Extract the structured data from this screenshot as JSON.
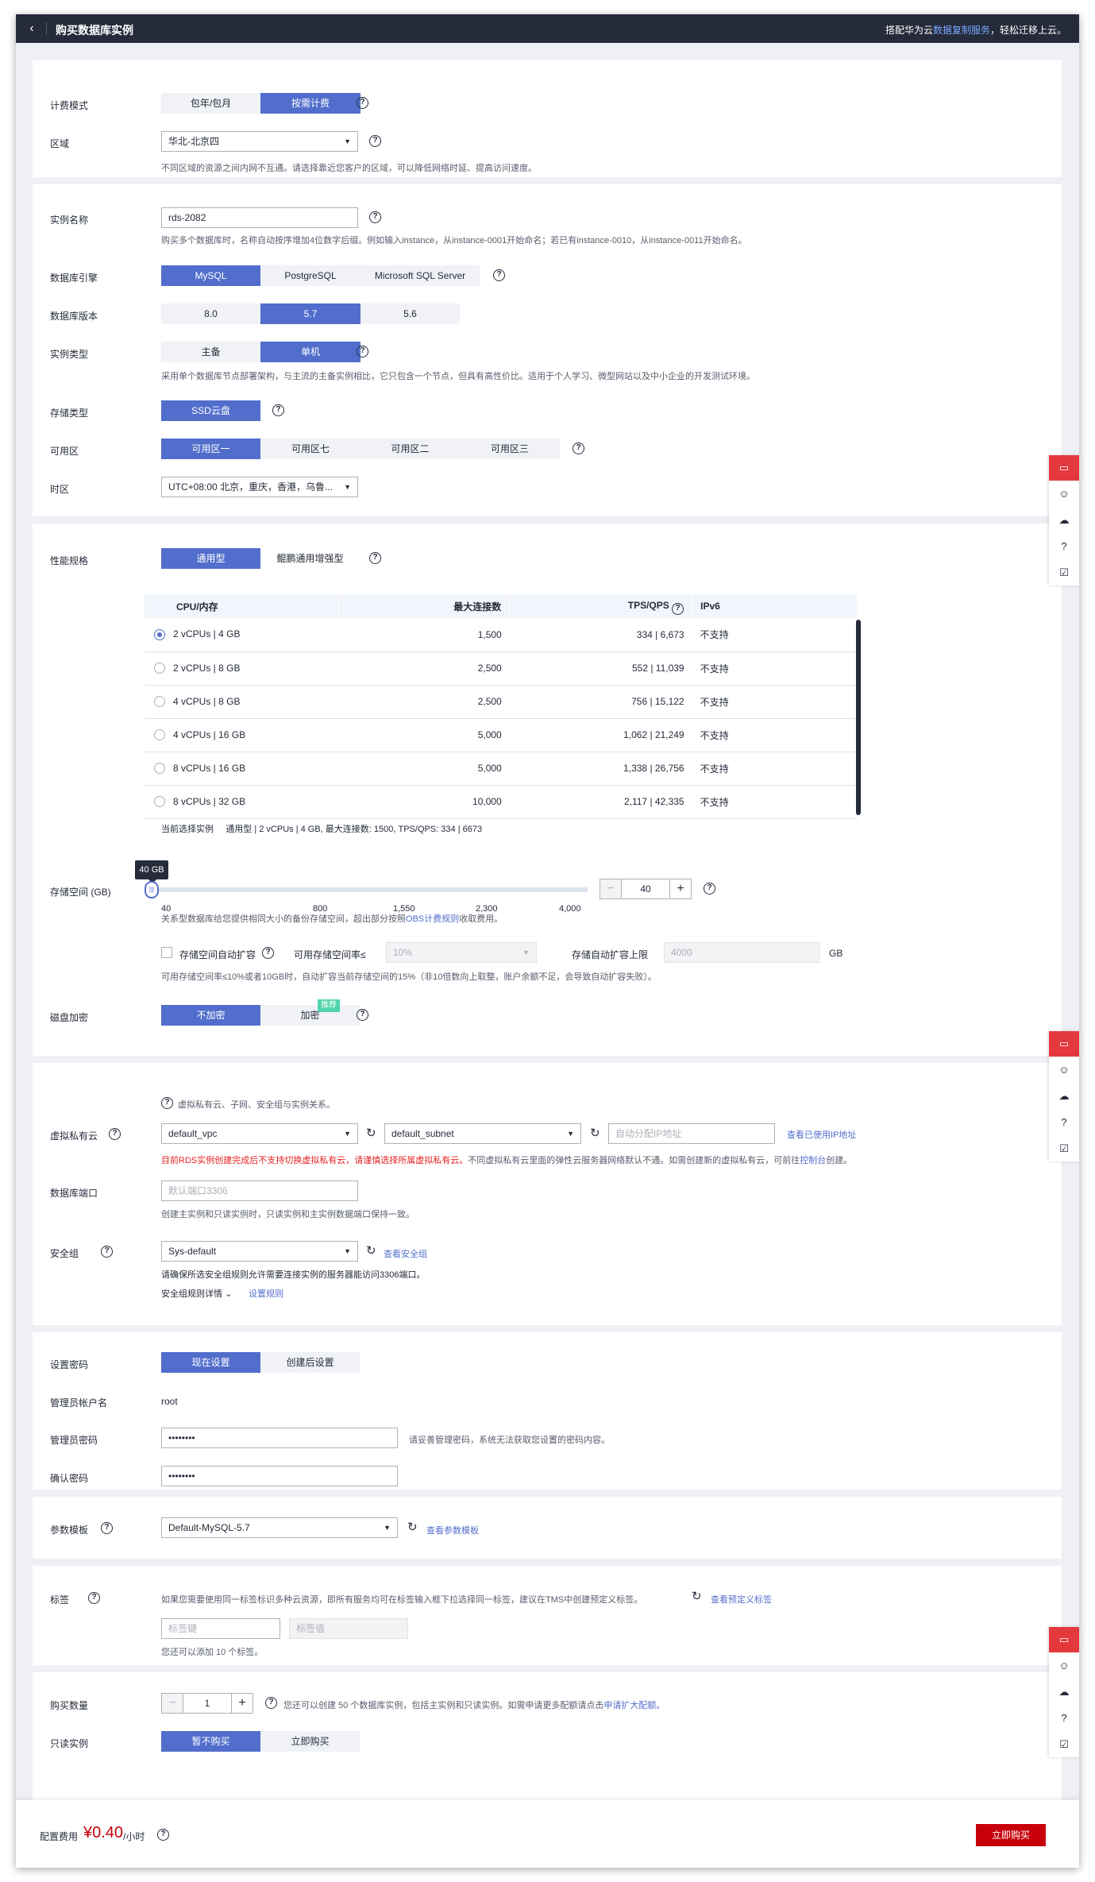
{
  "header": {
    "title": "购买数据库实例",
    "promo_prefix": "搭配华为云",
    "promo_link": "数据复制服务",
    "promo_suffix": "，轻松迁移上云。"
  },
  "billing": {
    "label": "计费模式",
    "options": [
      "包年/包月",
      "按需计费"
    ],
    "selected": "按需计费"
  },
  "region": {
    "label": "区域",
    "value": "华北-北京四",
    "note": "不同区域的资源之间内网不互通。请选择靠近您客户的区域，可以降低网络时延、提高访问速度。"
  },
  "instance_name": {
    "label": "实例名称",
    "value": "rds-2082",
    "note": "购买多个数据库时，名称自动按序增加4位数字后缀。例如输入instance，从instance-0001开始命名；若已有instance-0010，从instance-0011开始命名。"
  },
  "engine": {
    "label": "数据库引擎",
    "options": [
      "MySQL",
      "PostgreSQL",
      "Microsoft SQL Server"
    ]
  },
  "version": {
    "label": "数据库版本",
    "options": [
      "8.0",
      "5.7",
      "5.6"
    ]
  },
  "instance_type": {
    "label": "实例类型",
    "options": [
      "主备",
      "单机"
    ],
    "note": "采用单个数据库节点部署架构，与主流的主备实例相比，它只包含一个节点，但具有高性价比。适用于个人学习、微型网站以及中小企业的开发测试环境。"
  },
  "storage_type": {
    "label": "存储类型",
    "options": [
      "SSD云盘"
    ]
  },
  "az": {
    "label": "可用区",
    "options": [
      "可用区一",
      "可用区七",
      "可用区二",
      "可用区三"
    ]
  },
  "timezone": {
    "label": "时区",
    "value": "UTC+08:00 北京，重庆，香港，乌鲁..."
  },
  "spec": {
    "label": "性能规格",
    "options": [
      "通用型",
      "鲲鹏通用增强型"
    ],
    "columns": [
      "CPU/内存",
      "最大连接数",
      "TPS/QPS",
      "IPv6"
    ],
    "rows": [
      {
        "cpu": "2 vCPUs | 4 GB",
        "conn": "1,500",
        "tps": "334 | 6,673",
        "ipv6": "不支持"
      },
      {
        "cpu": "2 vCPUs | 8 GB",
        "conn": "2,500",
        "tps": "552 | 11,039",
        "ipv6": "不支持"
      },
      {
        "cpu": "4 vCPUs | 8 GB",
        "conn": "2,500",
        "tps": "756 | 15,122",
        "ipv6": "不支持"
      },
      {
        "cpu": "4 vCPUs | 16 GB",
        "conn": "5,000",
        "tps": "1,062 | 21,249",
        "ipv6": "不支持"
      },
      {
        "cpu": "8 vCPUs | 16 GB",
        "conn": "5,000",
        "tps": "1,338 | 26,756",
        "ipv6": "不支持"
      },
      {
        "cpu": "8 vCPUs | 32 GB",
        "conn": "10,000",
        "tps": "2,117 | 42,335",
        "ipv6": "不支持"
      }
    ],
    "current_label": "当前选择实例",
    "current_value": "通用型 | 2 vCPUs | 4 GB, 最大连接数: 1500, TPS/QPS: 334 | 6673"
  },
  "storage": {
    "label": "存储空间 (GB)",
    "tooltip": "40 GB",
    "ticks": [
      "40",
      "800",
      "1,550",
      "2,300",
      "4,000"
    ],
    "value": "40",
    "note_prefix": "关系型数据库给您提供相同大小的备份存储空间，超出部分按照",
    "note_link": "OBS计费规则",
    "note_suffix": "收取费用。",
    "auto_label": "存储空间自动扩容",
    "avail_label": "可用存储空间率≤",
    "avail_value": "10%",
    "limit_label": "存储自动扩容上限",
    "limit_value": "4000",
    "limit_unit": "GB",
    "auto_note": "可用存储空间率≤10%或者10GB时，自动扩容当前存储空间的15%（非10倍数向上取整，账户余额不足，会导致自动扩容失败）。"
  },
  "encrypt": {
    "label": "磁盘加密",
    "options": [
      "不加密",
      "加密"
    ],
    "badge": "推荐"
  },
  "network": {
    "info": "虚拟私有云、子网、安全组与实例关系。",
    "vpc_label": "虚拟私有云",
    "vpc_value": "default_vpc",
    "subnet_value": "default_subnet",
    "ip_placeholder": "自动分配IP地址",
    "ip_link": "查看已使用IP地址",
    "warn_red": "目前RDS实例创建完成后不支持切换虚拟私有云，请谨慎选择所属虚拟私有云。",
    "warn_rest": "不同虚拟私有云里面的弹性云服务器网络默认不通。如需创建新的虚拟私有云，可前往",
    "warn_link": "控制台",
    "warn_end": "创建。",
    "port_label": "数据库端口",
    "port_placeholder": "默认端口3306",
    "port_note": "创建主实例和只读实例时，只读实例和主实例数据端口保持一致。",
    "sg_label": "安全组",
    "sg_value": "Sys-default",
    "sg_link": "查看安全组",
    "sg_note": "请确保所选安全组规则允许需要连接实例的服务器能访问3306端口。",
    "sg_rules": "安全组规则详情",
    "sg_set": "设置规则"
  },
  "password": {
    "label": "设置密码",
    "options": [
      "现在设置",
      "创建后设置"
    ],
    "admin_label": "管理员帐户名",
    "admin_value": "root",
    "pwd_label": "管理员密码",
    "pwd_value": "••••••••",
    "pwd_note": "请妥善管理密码，系统无法获取您设置的密码内容。",
    "confirm_label": "确认密码",
    "confirm_value": "••••••••"
  },
  "param": {
    "label": "参数模板",
    "value": "Default-MySQL-5.7",
    "link": "查看参数模板"
  },
  "tags": {
    "label": "标签",
    "note": "如果您需要使用同一标签标识多种云资源，即所有服务均可在标签输入框下拉选择同一标签，建议在TMS中创建预定义标签。",
    "link": "查看预定义标签",
    "key_placeholder": "标签键",
    "value_placeholder": "标签值",
    "remain": "您还可以添加 10 个标签。"
  },
  "purchase": {
    "qty_label": "购买数量",
    "qty_value": "1",
    "qty_note": "您还可以创建 50 个数据库实例，包括主实例和只读实例。如需申请更多配额请点击",
    "qty_link": "申请扩大配额。",
    "ro_label": "只读实例",
    "ro_options": [
      "暂不购买",
      "立即购买"
    ]
  },
  "footer": {
    "fee_label": "配置费用",
    "price": "¥0.40",
    "unit": "/小时",
    "buy": "立即购买"
  },
  "colors": {
    "primary": "#526ecc",
    "brand_red": "#c7000b",
    "dark": "#252b3a"
  }
}
